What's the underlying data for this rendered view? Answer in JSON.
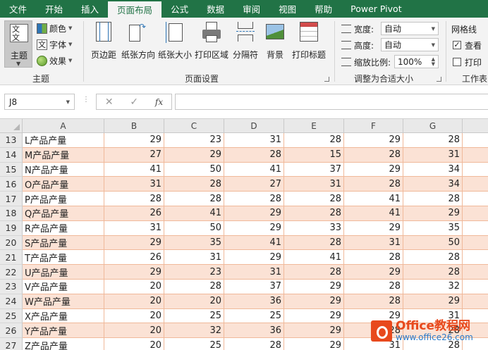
{
  "tabs": [
    {
      "label": "文件",
      "active": false
    },
    {
      "label": "开始",
      "active": false
    },
    {
      "label": "插入",
      "active": false
    },
    {
      "label": "页面布局",
      "active": true
    },
    {
      "label": "公式",
      "active": false
    },
    {
      "label": "数据",
      "active": false
    },
    {
      "label": "审阅",
      "active": false
    },
    {
      "label": "视图",
      "active": false
    },
    {
      "label": "帮助",
      "active": false
    },
    {
      "label": "Power Pivot",
      "active": false
    }
  ],
  "ribbon": {
    "theme_group": {
      "label": "主题",
      "theme_button": "主题",
      "theme_icon_text": "文 文",
      "colors": "颜色",
      "fonts": "字体",
      "effects": "效果"
    },
    "page_setup_group": {
      "label": "页面设置",
      "buttons": [
        "页边距",
        "纸张方向",
        "纸张大小",
        "打印区域",
        "分隔符",
        "背景",
        "打印标题"
      ]
    },
    "scale_group": {
      "label": "调整为合适大小",
      "width_label": "宽度:",
      "width_value": "自动",
      "height_label": "高度:",
      "height_value": "自动",
      "scale_label": "缩放比例:",
      "scale_value": "100%"
    },
    "sheet_options_group": {
      "label": "工作表",
      "gridlines_label": "网格线",
      "view_label": "查看",
      "view_checked": true,
      "print_label": "打印",
      "print_checked": false
    }
  },
  "formula_bar": {
    "name_box": "J8",
    "fx_label": "fx",
    "cancel_glyph": "✕",
    "enter_glyph": "✓",
    "formula": ""
  },
  "columns": [
    "A",
    "B",
    "C",
    "D",
    "E",
    "F",
    "G"
  ],
  "rows": [
    {
      "num": "13",
      "name": "L产品产量",
      "vals": [
        "29",
        "23",
        "31",
        "28",
        "29",
        "28"
      ]
    },
    {
      "num": "14",
      "name": "M产品产量",
      "vals": [
        "27",
        "29",
        "28",
        "15",
        "28",
        "31"
      ]
    },
    {
      "num": "15",
      "name": "N产品产量",
      "vals": [
        "41",
        "50",
        "41",
        "37",
        "29",
        "34"
      ]
    },
    {
      "num": "16",
      "name": "O产品产量",
      "vals": [
        "31",
        "28",
        "27",
        "31",
        "28",
        "34"
      ]
    },
    {
      "num": "17",
      "name": "P产品产量",
      "vals": [
        "28",
        "28",
        "28",
        "28",
        "41",
        "28"
      ]
    },
    {
      "num": "18",
      "name": "Q产品产量",
      "vals": [
        "26",
        "41",
        "29",
        "28",
        "41",
        "29"
      ]
    },
    {
      "num": "19",
      "name": "R产品产量",
      "vals": [
        "31",
        "50",
        "29",
        "33",
        "29",
        "35"
      ]
    },
    {
      "num": "20",
      "name": "S产品产量",
      "vals": [
        "29",
        "35",
        "41",
        "28",
        "31",
        "50"
      ]
    },
    {
      "num": "21",
      "name": "T产品产量",
      "vals": [
        "26",
        "31",
        "29",
        "41",
        "28",
        "28"
      ]
    },
    {
      "num": "22",
      "name": "U产品产量",
      "vals": [
        "29",
        "23",
        "31",
        "28",
        "29",
        "28"
      ]
    },
    {
      "num": "23",
      "name": "V产品产量",
      "vals": [
        "20",
        "28",
        "37",
        "29",
        "28",
        "32"
      ]
    },
    {
      "num": "24",
      "name": "W产品产量",
      "vals": [
        "20",
        "20",
        "36",
        "29",
        "28",
        "29"
      ]
    },
    {
      "num": "25",
      "name": "X产品产量",
      "vals": [
        "20",
        "25",
        "25",
        "29",
        "29",
        "31"
      ]
    },
    {
      "num": "26",
      "name": "Y产品产量",
      "vals": [
        "20",
        "32",
        "36",
        "29",
        "28",
        "28"
      ]
    },
    {
      "num": "27",
      "name": "Z产品产量",
      "vals": [
        "20",
        "25",
        "28",
        "29",
        "31",
        "28"
      ]
    }
  ],
  "watermark": {
    "title": "Office教程网",
    "url": "www.office26.com"
  }
}
